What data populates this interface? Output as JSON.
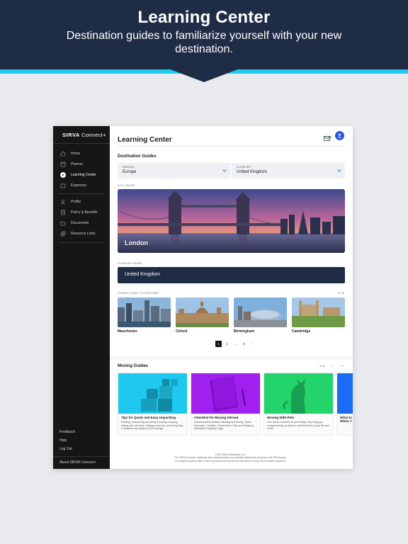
{
  "promo": {
    "title": "Learning Center",
    "subtitle": "Destination guides to familiarize yourself with your new destination."
  },
  "sidebar": {
    "logo_brand": "SIRVA",
    "logo_product": "Connect+",
    "nav": [
      {
        "label": "Home",
        "icon": "home-icon"
      },
      {
        "label": "Planner",
        "icon": "planner-icon"
      },
      {
        "label": "Learning Center",
        "icon": "compass-icon",
        "active": true
      },
      {
        "label": "Expenses",
        "icon": "expenses-icon"
      },
      {
        "label": "Profile",
        "icon": "profile-icon"
      },
      {
        "label": "Policy & Benefits",
        "icon": "policy-icon"
      },
      {
        "label": "Documents",
        "icon": "folder-icon"
      },
      {
        "label": "Resource Links",
        "icon": "link-icon"
      }
    ],
    "bottom_links": [
      "Feedback",
      "Help",
      "Log Out"
    ],
    "about": "About SIRVA Connect+"
  },
  "header": {
    "title": "Learning Center"
  },
  "destination": {
    "section_title": "Destination Guides",
    "region_label": "REGION",
    "region_value": "Europe",
    "country_label": "COUNTRY",
    "country_value": "United Kingdom"
  },
  "city_guide": {
    "label": "CITY GUIDE",
    "city": "London"
  },
  "country_guide": {
    "label": "COUNTRY GUIDE",
    "country": "United Kingdom"
  },
  "other_cities": {
    "label": "OTHER CITIES TO EXPLORE",
    "count": "4 / 10",
    "cities": [
      "Manchester",
      "Oxford",
      "Birmingham",
      "Cambridge"
    ]
  },
  "pagination": {
    "pages": [
      "1",
      "2",
      "...",
      "8"
    ],
    "next": "›"
  },
  "moving_guides": {
    "title": "Moving Guides",
    "count": "4 / 8",
    "prev": "←",
    "next": "→",
    "cards": [
      {
        "title": "Tips for Quick and Easy Unpacking",
        "desc": "Packing, researching and hiring a moving company, selling your old home, finding a new one, and everything in between can require a lot of energy.",
        "color": "#1ec8ef"
      },
      {
        "title": "Checklist for Moving Abroad",
        "desc": "Documentation Needed, Banking and Money, Taxes, Insurance, Charities, Government, Civic and Religious, Education, Property, Legal.",
        "color": "#a020f0"
      },
      {
        "title": "Moving With Pets",
        "desc": "Your pet is a member of your family; they bring joy, companionship, protection, and liveliness to your life and home.",
        "color": "#22d46a"
      },
      {
        "title": "What to When Y",
        "desc": "",
        "color": "#1a6cf5"
      }
    ]
  },
  "footer": {
    "copyright": "©2020 SIRVA Worldwide, Inc.",
    "line1": "The SIRVA Connect+ trademark and sirvaconnectplus.com website address are property of the SIRVA group",
    "line2": "of companies used to offer a suite of products and services for relocation, moving and real estate purposes."
  }
}
